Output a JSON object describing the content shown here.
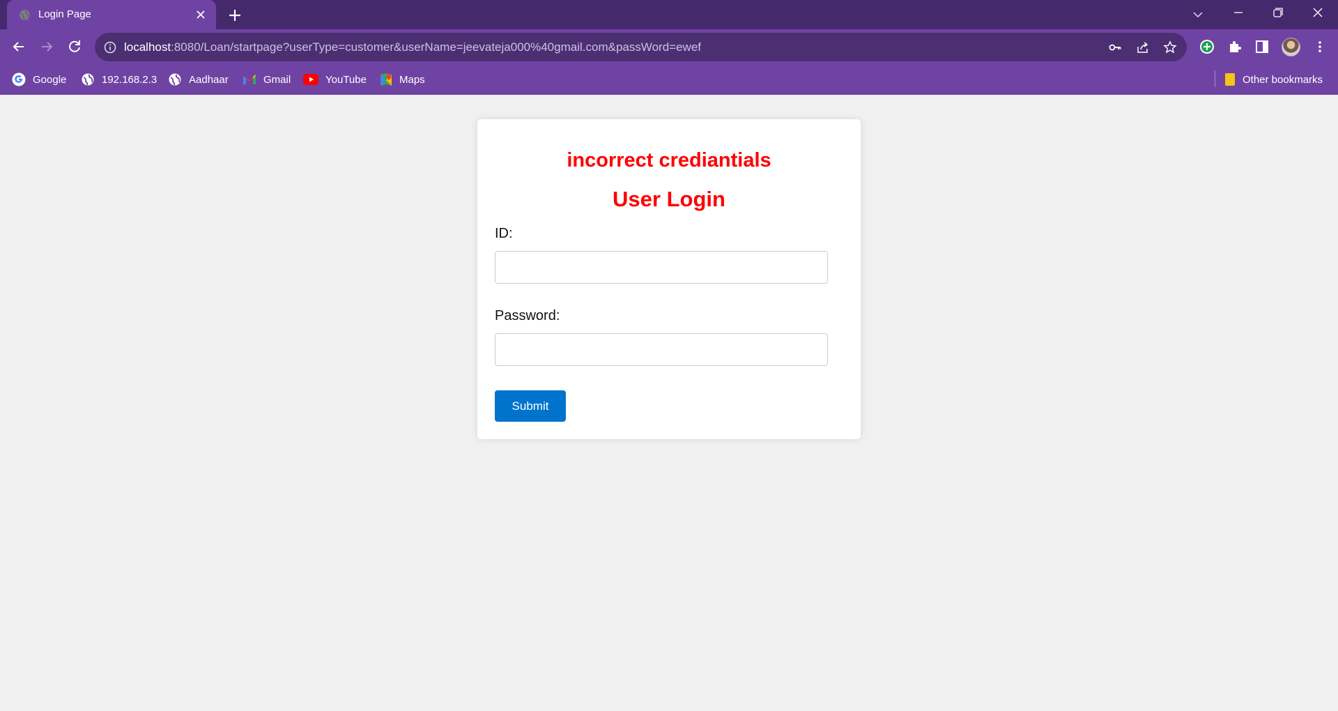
{
  "browser": {
    "tab": {
      "title": "Login Page",
      "favicon": "globe-icon"
    },
    "address_bar": {
      "host": "localhost",
      "path": ":8080/Loan/startpage?userType=customer&userName=jeevateja000%40gmail.com&passWord=ewef"
    },
    "bookmarks": [
      {
        "label": "Google",
        "icon": "google-icon"
      },
      {
        "label": "192.168.2.3",
        "icon": "globe-icon"
      },
      {
        "label": "Aadhaar",
        "icon": "globe-icon"
      },
      {
        "label": "Gmail",
        "icon": "gmail-icon"
      },
      {
        "label": "YouTube",
        "icon": "youtube-icon"
      },
      {
        "label": "Maps",
        "icon": "maps-icon"
      }
    ],
    "other_bookmarks": "Other bookmarks"
  },
  "page": {
    "error_message": "incorrect crediantials",
    "heading": "User Login",
    "id_label": "ID:",
    "id_value": "",
    "password_label": "Password:",
    "password_value": "",
    "submit_label": "Submit"
  },
  "colors": {
    "tabstrip": "#45296d",
    "toolbar": "#6f43a3",
    "error_text": "#ff0000",
    "submit_button": "#0074cc",
    "page_background": "#f0f0f0"
  }
}
